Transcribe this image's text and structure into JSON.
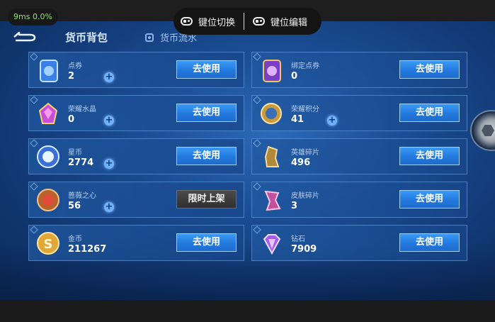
{
  "perf": {
    "text": "9ms  0.0%"
  },
  "keybar": {
    "switch_label": "键位切换",
    "edit_label": "键位编辑"
  },
  "tabs": {
    "bag": "货币背包",
    "flow": "货币流水"
  },
  "accent": "#2a86e8",
  "items": [
    {
      "name": "点券",
      "value": "2",
      "action": "去使用",
      "icon": "ticket-icon",
      "plus": true
    },
    {
      "name": "绑定点券",
      "value": "0",
      "action": "去使用",
      "icon": "bound-ticket-icon",
      "plus": false
    },
    {
      "name": "荣耀水晶",
      "value": "0",
      "action": "去使用",
      "icon": "crystal-icon",
      "plus": true
    },
    {
      "name": "荣耀积分",
      "value": "41",
      "action": "去使用",
      "icon": "honor-points-icon",
      "plus": true
    },
    {
      "name": "星币",
      "value": "2774",
      "action": "去使用",
      "icon": "star-coin-icon",
      "plus": true
    },
    {
      "name": "英雄碎片",
      "value": "496",
      "action": "去使用",
      "icon": "hero-fragment-icon",
      "plus": false
    },
    {
      "name": "蔷薇之心",
      "value": "56",
      "action": "限时上架",
      "icon": "rose-heart-icon",
      "plus": true,
      "disabled": true
    },
    {
      "name": "皮肤碎片",
      "value": "3",
      "action": "去使用",
      "icon": "skin-fragment-icon",
      "plus": false
    },
    {
      "name": "金币",
      "value": "211267",
      "action": "去使用",
      "icon": "gold-coin-icon",
      "plus": false
    },
    {
      "name": "钻石",
      "value": "7909",
      "action": "去使用",
      "icon": "diamond-icon",
      "plus": false
    }
  ]
}
